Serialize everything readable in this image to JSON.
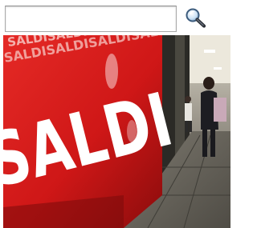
{
  "search": {
    "value": "",
    "placeholder": ""
  },
  "search_button": {
    "icon": "magnifier-icon"
  },
  "photo": {
    "sign_text": "SALDI",
    "sign_pattern_text": "SALDISALDISALDISALDI",
    "colors": {
      "sign_red": "#d81e1e",
      "sign_dark": "#8e0d0d",
      "floor": "#6d6a63",
      "wall": "#c9c4b4"
    }
  }
}
